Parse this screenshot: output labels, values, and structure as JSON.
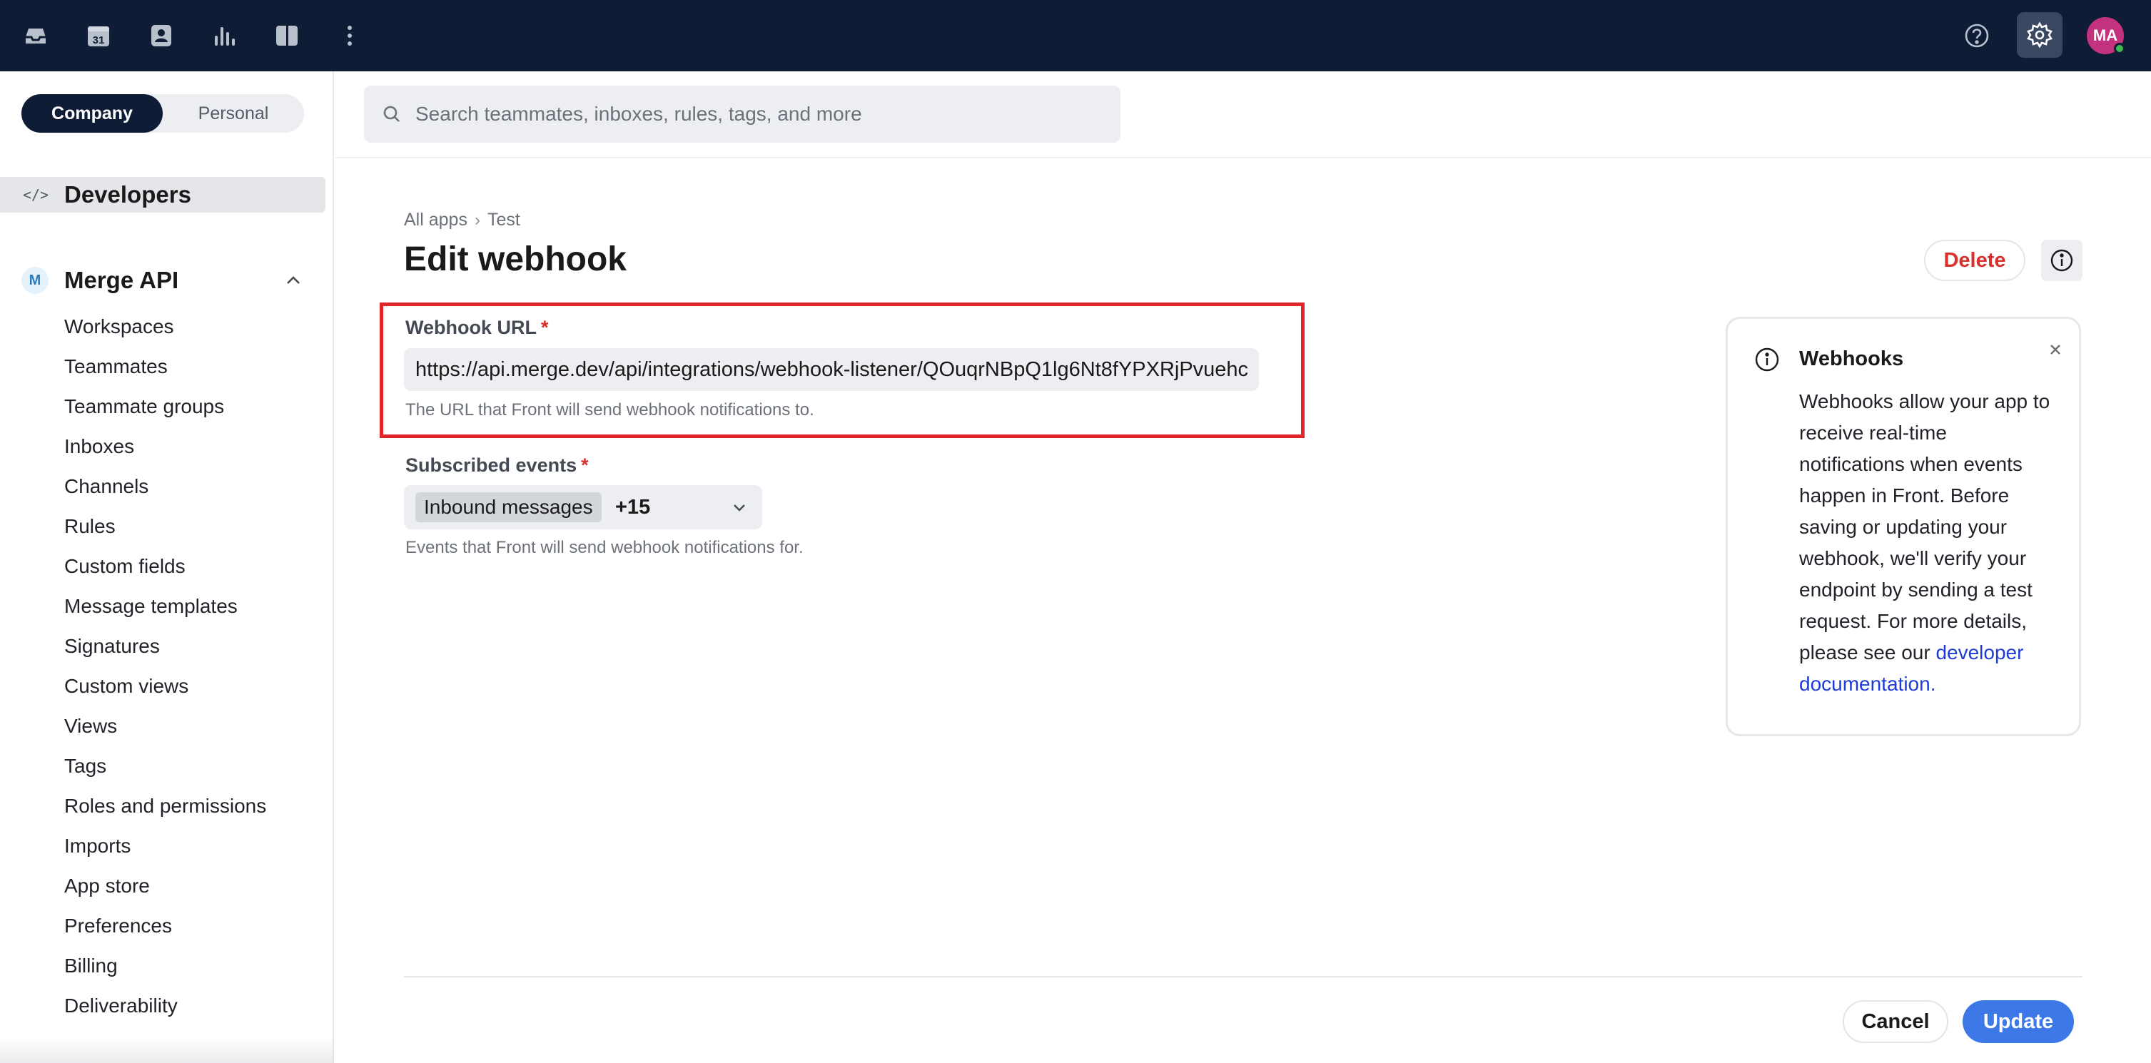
{
  "topbar": {
    "icons": [
      "inbox-icon",
      "calendar-icon",
      "contacts-icon",
      "analytics-icon",
      "split-view-icon",
      "more-icon"
    ],
    "calendar_day": "31",
    "help_icon": "help-icon",
    "settings_icon": "gear-icon",
    "avatar_initials": "MA",
    "avatar_color": "#c2327d",
    "bar_color": "#0e1c36"
  },
  "sidebar": {
    "scope": {
      "company": "Company",
      "personal": "Personal",
      "selected": "Company"
    },
    "section_title": "Developers",
    "section_icon": "</>",
    "app": {
      "badge": "M",
      "name": "Merge API",
      "expanded": true
    },
    "items": [
      "Workspaces",
      "Teammates",
      "Teammate groups",
      "Inboxes",
      "Channels",
      "Rules",
      "Custom fields",
      "Message templates",
      "Signatures",
      "Custom views",
      "Views",
      "Tags",
      "Roles and permissions",
      "Imports",
      "App store",
      "Preferences",
      "Billing",
      "Deliverability"
    ]
  },
  "search": {
    "placeholder": "Search teammates, inboxes, rules, tags, and more"
  },
  "main": {
    "breadcrumb": {
      "root": "All apps",
      "current": "Test"
    },
    "title": "Edit webhook",
    "delete_label": "Delete",
    "webhook_url": {
      "label": "Webhook URL",
      "required_mark": "*",
      "value": "https://api.merge.dev/api/integrations/webhook-listener/QOuqrNBpQ1lg6Nt8fYPXRjPvuehc",
      "helper": "The URL that Front will send webhook notifications to."
    },
    "events": {
      "label": "Subscribed events",
      "required_mark": "*",
      "selected_chip": "Inbound messages",
      "more_count": "+15",
      "helper": "Events that Front will send webhook notifications for."
    },
    "info_panel": {
      "title": "Webhooks",
      "body": "Webhooks allow your app to receive real-time notifications when events happen in Front. Before saving or updating your webhook, we'll verify your endpoint by sending a test request. For more details, please see our ",
      "link_text": "developer documentation",
      "suffix": "."
    },
    "footer": {
      "cancel_label": "Cancel",
      "update_label": "Update"
    },
    "colors": {
      "accent": "#3c78e8",
      "danger": "#d8312b",
      "link": "#1f3bd6",
      "highlight": "#e0262a"
    }
  }
}
